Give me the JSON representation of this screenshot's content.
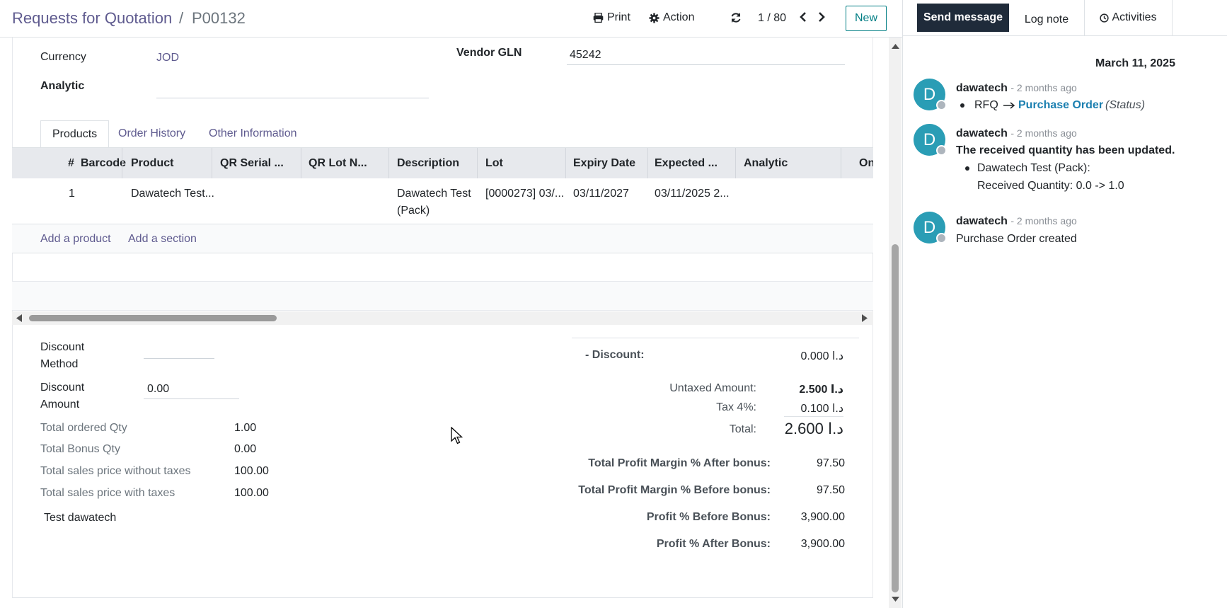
{
  "header": {
    "breadcrumb_parent": "Requests for Quotation",
    "breadcrumb_sep": "/",
    "breadcrumb_current": "P00132",
    "print_label": "Print",
    "action_label": "Action",
    "pager": "1 / 80",
    "new_label": "New"
  },
  "form": {
    "currency_label": "Currency",
    "currency_value": "JOD",
    "analytic_label": "Analytic",
    "vendor_gln_label": "Vendor GLN",
    "vendor_gln_value": "45242"
  },
  "tabs": [
    {
      "label": "Products"
    },
    {
      "label": "Order History"
    },
    {
      "label": "Other Information"
    }
  ],
  "table": {
    "columns": [
      "#",
      "Barcode",
      "Product",
      "QR Serial ...",
      "QR Lot N...",
      "Description",
      "Lot",
      "Expiry Date",
      "Expected ...",
      "Analytic",
      "On"
    ],
    "rows": [
      {
        "num": "1",
        "barcode": "",
        "product": "Dawatech Test...",
        "qr_serial": "",
        "qr_lot": "",
        "description_line1": "Dawatech Test",
        "description_line2": "(Pack)",
        "lot": "[0000273] 03/...",
        "expiry": "03/11/2027",
        "expected": "03/11/2025 2...",
        "analytic": ""
      }
    ],
    "add_product": "Add a product",
    "add_section": "Add a section"
  },
  "bottom_left": {
    "discount_method_label1": "Discount",
    "discount_method_label2": "Method",
    "discount_amount_label1": "Discount",
    "discount_amount_label2": "Amount",
    "discount_amount_value": "0.00",
    "stats": [
      {
        "label": "Total ordered Qty",
        "value": "1.00"
      },
      {
        "label": "Total Bonus Qty",
        "value": "0.00"
      },
      {
        "label": "Total sales price without taxes",
        "value": "100.00"
      },
      {
        "label": "Total sales price with taxes",
        "value": "100.00"
      }
    ],
    "note": "Test dawatech"
  },
  "totals": {
    "discount_label": "- Discount:",
    "discount_value": "0.000 د.ا",
    "untaxed_label": "Untaxed Amount:",
    "untaxed_value": "2.500 د.ا",
    "tax_label": "Tax 4%:",
    "tax_value": "0.100 د.ا",
    "total_label": "Total:",
    "total_value": "2.600 د.ا",
    "margins": [
      {
        "label": "Total Profit Margin % After bonus:",
        "value": "97.50"
      },
      {
        "label": "Total Profit Margin % Before bonus:",
        "value": "97.50"
      },
      {
        "label": "Profit % Before Bonus:",
        "value": "3,900.00"
      },
      {
        "label": "Profit % After Bonus:",
        "value": "3,900.00"
      }
    ]
  },
  "chatter": {
    "send_message": "Send message",
    "log_note": "Log note",
    "activities": "Activities",
    "date": "March 11, 2025",
    "messages": [
      {
        "initial": "D",
        "author": "dawatech",
        "ago": "- 2 months ago",
        "from": "RFQ",
        "to": "Purchase Order",
        "field": "(Status)"
      },
      {
        "initial": "D",
        "author": "dawatech",
        "ago": "- 2 months ago",
        "text": "The received quantity has been updated.",
        "item": "Dawatech Test (Pack):",
        "detail": "Received Quantity: 0.0 -> 1.0"
      },
      {
        "initial": "D",
        "author": "dawatech",
        "ago": "- 2 months ago",
        "text": "Purchase Order created"
      }
    ]
  },
  "colors": {
    "brand_purple": "#5f5b8f",
    "teal": "#017e84",
    "avatar": "#2a9db5",
    "dark_button": "#1f2b3a",
    "link_blue": "#1b7fb0"
  }
}
